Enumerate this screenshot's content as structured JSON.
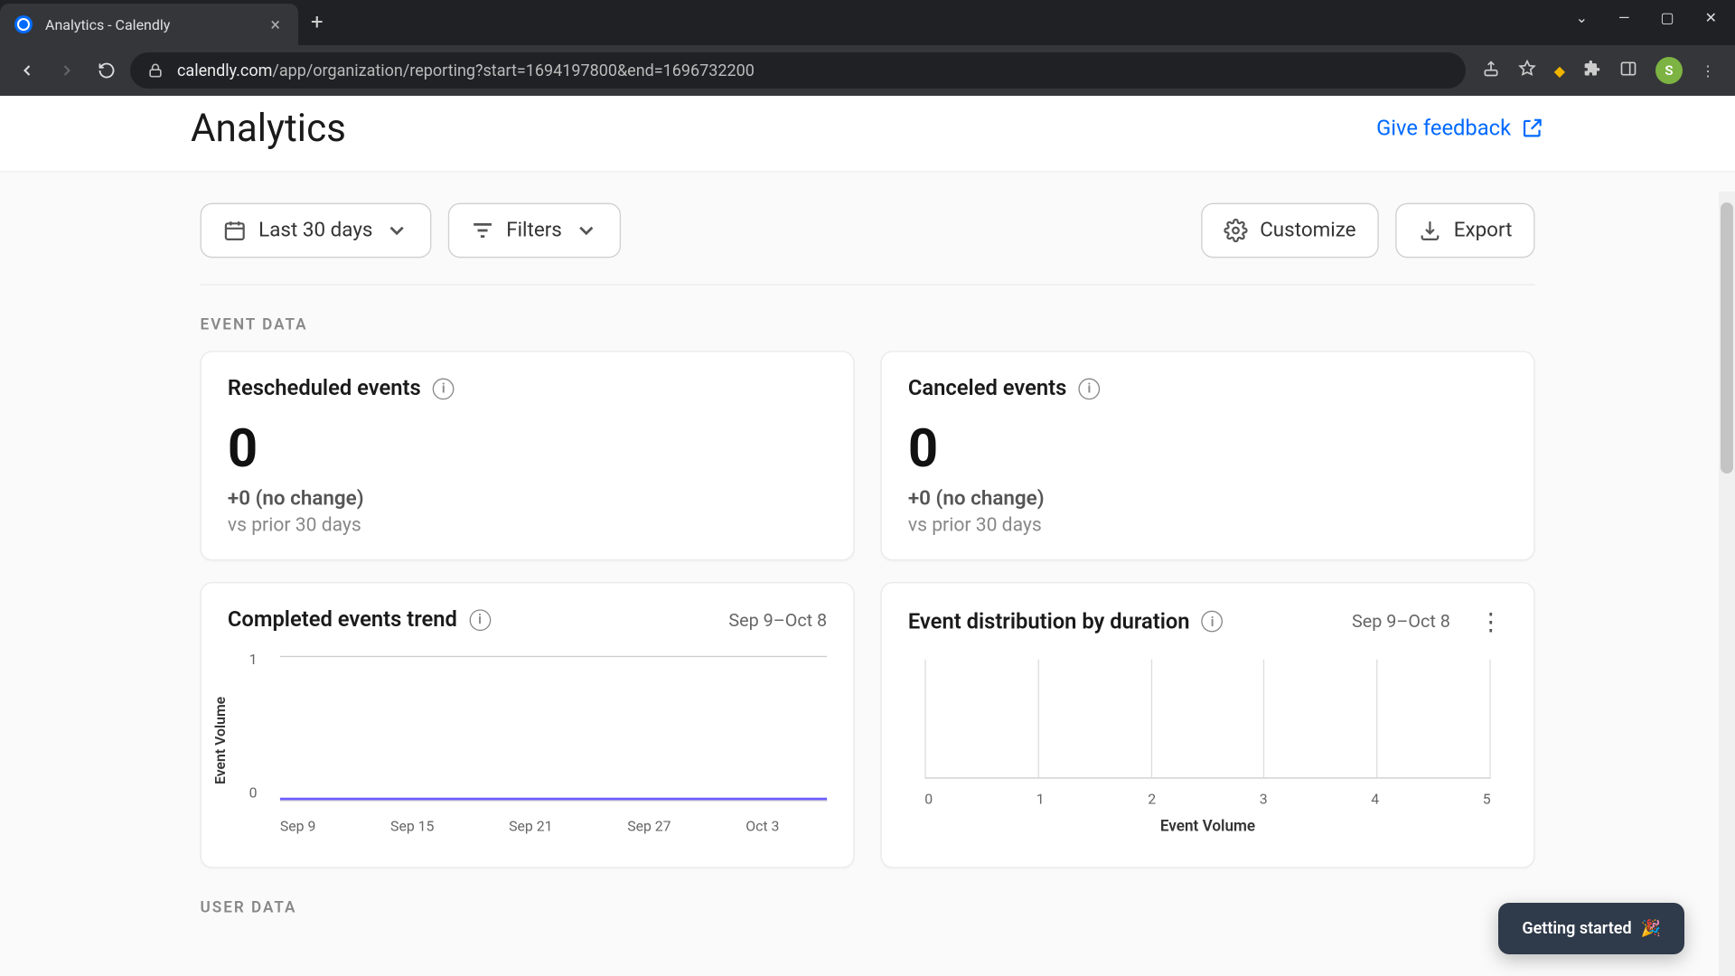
{
  "browser": {
    "tab_title": "Analytics - Calendly",
    "url_host": "calendly.com",
    "url_path": "/app/organization/reporting?start=1694197800&end=1696732200",
    "avatar_initial": "S"
  },
  "header": {
    "title": "Analytics",
    "feedback": "Give feedback"
  },
  "toolbar": {
    "date_range": "Last 30 days",
    "filters": "Filters",
    "customize": "Customize",
    "export": "Export"
  },
  "sections": {
    "event_data": "EVENT DATA",
    "user_data": "USER DATA"
  },
  "cards": {
    "rescheduled": {
      "title": "Rescheduled events",
      "value": "0",
      "change": "+0 (no change)",
      "vs": "vs prior 30 days"
    },
    "canceled": {
      "title": "Canceled events",
      "value": "0",
      "change": "+0 (no change)",
      "vs": "vs prior 30 days"
    },
    "trend": {
      "title": "Completed events trend",
      "range": "Sep 9–Oct 8"
    },
    "distribution": {
      "title": "Event distribution by duration",
      "range": "Sep 9–Oct 8"
    }
  },
  "chart_data": [
    {
      "type": "line",
      "title": "Completed events trend",
      "ylabel": "Event Volume",
      "xlabel": "",
      "ylim": [
        0,
        1
      ],
      "y_ticks": [
        "1",
        "0"
      ],
      "categories": [
        "Sep 9",
        "Sep 15",
        "Sep 21",
        "Sep 27",
        "Oct 3"
      ],
      "values": [
        0,
        0,
        0,
        0,
        0
      ]
    },
    {
      "type": "bar",
      "title": "Event distribution by duration",
      "xlabel": "Event Volume",
      "ylabel": "",
      "xlim": [
        0,
        5
      ],
      "x_ticks": [
        "0",
        "1",
        "2",
        "3",
        "4",
        "5"
      ],
      "categories": [],
      "values": []
    }
  ],
  "help": {
    "label": "Getting started",
    "emoji": "🎉"
  }
}
